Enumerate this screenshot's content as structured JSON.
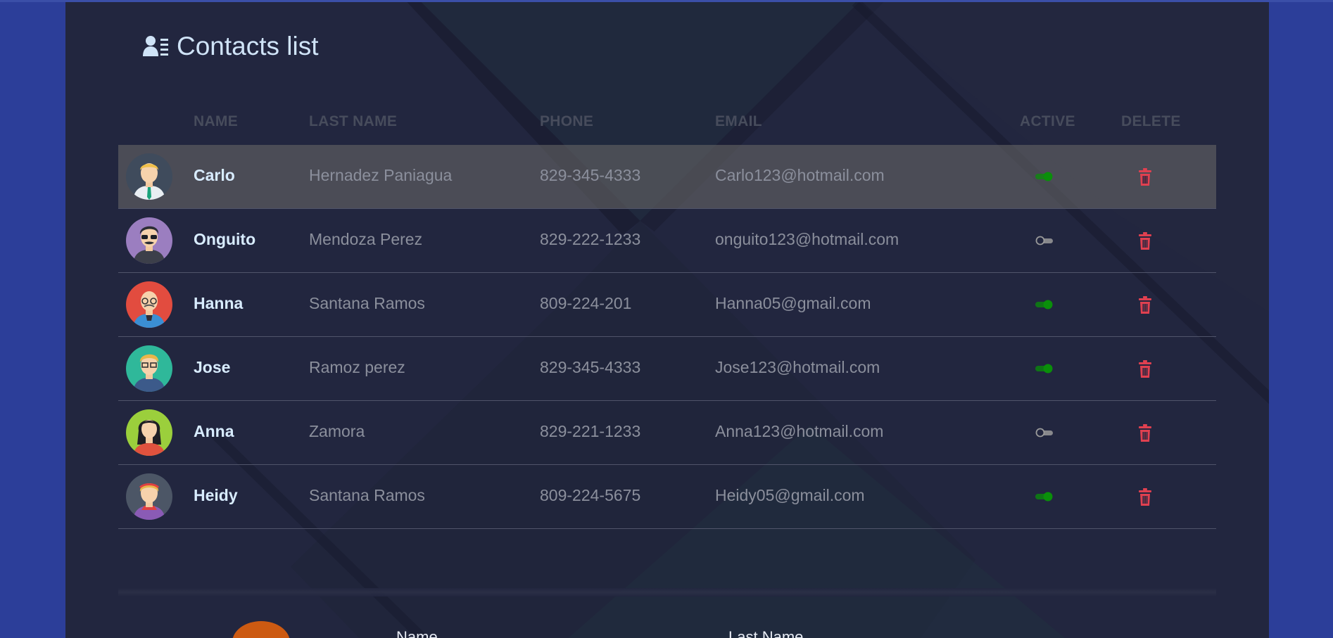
{
  "title": "Contacts list",
  "title_icon": "contacts-list-icon",
  "colors": {
    "page_bg": "#2c3e99",
    "panel_bg": "#22263f",
    "title": "#cfe3f7",
    "name": "#d8ecff",
    "muted_text": "#8b8f9c",
    "header_text": "#474c5c",
    "active_on": "#0a8f0a",
    "active_off": "#9a9a9a",
    "delete": "#e04050",
    "highlight_row": "#5e5e62"
  },
  "table": {
    "headers": {
      "name": "NAME",
      "last_name": "LAST NAME",
      "phone": "PHONE",
      "email": "EMAIL",
      "active": "ACTIVE",
      "delete": "DELETE"
    },
    "rows": [
      {
        "name": "Carlo",
        "last_name": "Hernadez Paniagua",
        "phone": "829-345-4333",
        "email": "Carlo123@hotmail.com",
        "active": true,
        "avatar": "man-tie-avatar",
        "highlighted": true
      },
      {
        "name": "Onguito",
        "last_name": "Mendoza Perez",
        "phone": "829-222-1233",
        "email": "onguito123@hotmail.com",
        "active": false,
        "avatar": "man-sunglasses-avatar",
        "highlighted": false
      },
      {
        "name": "Hanna",
        "last_name": "Santana Ramos",
        "phone": "809-224-201",
        "email": "Hanna05@gmail.com",
        "active": true,
        "avatar": "old-man-glasses-avatar",
        "highlighted": false
      },
      {
        "name": "Jose",
        "last_name": "Ramoz perez",
        "phone": "829-345-4333",
        "email": "Jose123@hotmail.com",
        "active": true,
        "avatar": "man-blond-glasses-avatar",
        "highlighted": false
      },
      {
        "name": "Anna",
        "last_name": "Zamora",
        "phone": "829-221-1233",
        "email": "Anna123@hotmail.com",
        "active": false,
        "avatar": "woman-dark-hair-avatar",
        "highlighted": false
      },
      {
        "name": "Heidy",
        "last_name": "Santana Ramos",
        "phone": "809-224-5675",
        "email": "Heidy05@gmail.com",
        "active": true,
        "avatar": "woman-headband-avatar",
        "highlighted": false
      }
    ]
  },
  "form": {
    "name_label": "Name",
    "last_name_label": "Last Name"
  },
  "icons": {
    "toggle": "toggle-icon",
    "delete": "trash-icon"
  }
}
